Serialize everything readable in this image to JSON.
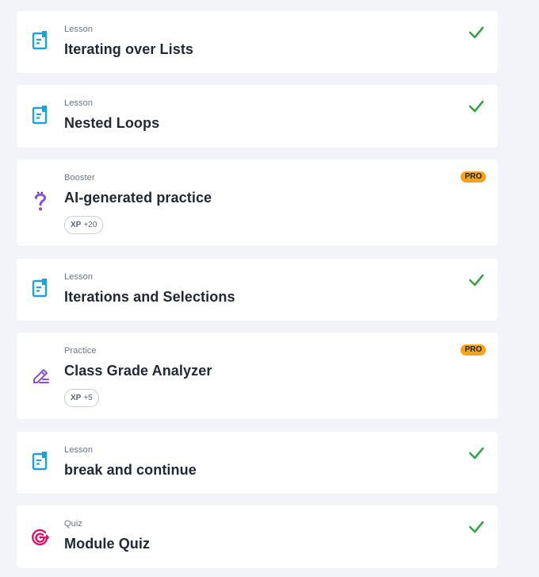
{
  "colors": {
    "background": "#f2f4f7",
    "card": "#ffffff",
    "lesson_icon": "#1ea1e0",
    "booster_icon": "#8a4fdc",
    "practice_icon": "#8a4fdc",
    "quiz_icon": "#e0106a",
    "check": "#3aa24a",
    "pro_badge": "#f6a31a"
  },
  "items": [
    {
      "kind": "Lesson",
      "title": "Iterating over Lists",
      "icon": "lesson-document-icon",
      "completed": true
    },
    {
      "kind": "Lesson",
      "title": "Nested Loops",
      "icon": "lesson-document-icon",
      "completed": true
    },
    {
      "kind": "Booster",
      "title": "AI-generated practice",
      "icon": "question-mark-icon",
      "pro": "PRO",
      "xp_label": "XP",
      "xp_value": "+20"
    },
    {
      "kind": "Lesson",
      "title": "Iterations and Selections",
      "icon": "lesson-document-icon",
      "completed": true
    },
    {
      "kind": "Practice",
      "title": "Class Grade Analyzer",
      "icon": "pencil-edit-icon",
      "pro": "PRO",
      "xp_label": "XP",
      "xp_value": "+5"
    },
    {
      "kind": "Lesson",
      "title": "break and continue",
      "icon": "lesson-document-icon",
      "completed": true
    },
    {
      "kind": "Quiz",
      "title": "Module Quiz",
      "icon": "target-icon",
      "completed": true
    }
  ]
}
